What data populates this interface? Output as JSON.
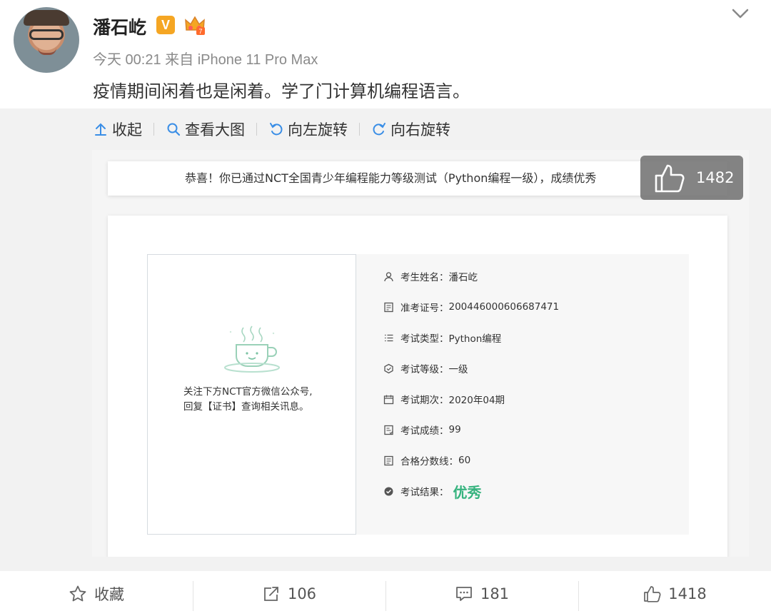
{
  "post": {
    "username": "潘石屹",
    "verified_badge": "V",
    "meta": "今天 00:21 来自 iPhone 11 Pro Max",
    "text": "疫情期间闲着也是闲着。学了门计算机编程语言。"
  },
  "toolbar": {
    "collapse": "收起",
    "view_large": "查看大图",
    "rotate_left": "向左旋转",
    "rotate_right": "向右旋转"
  },
  "certificate": {
    "banner": "恭喜！你已通过NCT全国青少年编程能力等级测试（Python编程一级），成绩优秀",
    "note_line1": "关注下方NCT官方微信公众号,",
    "note_line2": "回复【证书】查询相关讯息。",
    "fields": [
      {
        "label": "考生姓名：",
        "value": "潘石屹"
      },
      {
        "label": "准考证号：",
        "value": "200446000606687471"
      },
      {
        "label": "考试类型：",
        "value": "Python编程"
      },
      {
        "label": "考试等级：",
        "value": "一级"
      },
      {
        "label": "考试期次：",
        "value": "2020年04期"
      },
      {
        "label": "考试成绩：",
        "value": "99"
      },
      {
        "label": "合格分数线：",
        "value": "60"
      },
      {
        "label": "考试结果：",
        "value": "优秀"
      }
    ]
  },
  "like_overlay": {
    "count": "1482"
  },
  "actions": {
    "favorite": "收藏",
    "repost": "106",
    "comment": "181",
    "like": "1418"
  },
  "colors": {
    "result_green": "#36b37e",
    "badge_orange": "#f5a623",
    "panel_bg": "#f2f2f2"
  }
}
